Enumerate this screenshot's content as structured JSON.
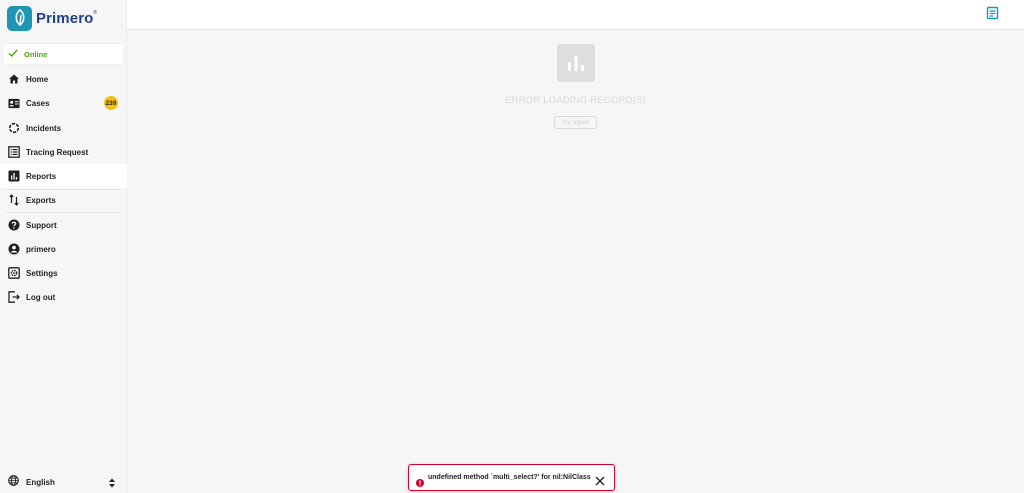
{
  "app": {
    "name": "Primero"
  },
  "status": {
    "label": "Online",
    "color": "#53a30a"
  },
  "nav": {
    "items": [
      {
        "label": "Home",
        "icon": "home-icon"
      },
      {
        "label": "Cases",
        "icon": "cases-card-icon",
        "badge": "239"
      },
      {
        "label": "Incidents",
        "icon": "incidents-icon"
      },
      {
        "label": "Tracing Request",
        "icon": "list-icon"
      },
      {
        "label": "Reports",
        "icon": "bar-chart-icon",
        "active": true
      },
      {
        "label": "Exports",
        "icon": "swap-arrows-icon"
      },
      {
        "label": "Support",
        "icon": "help-icon"
      },
      {
        "label": "primero",
        "icon": "account-icon"
      },
      {
        "label": "Settings",
        "icon": "settings-icon"
      },
      {
        "label": "Log out",
        "icon": "logout-icon"
      }
    ]
  },
  "language": {
    "selected": "English",
    "icon": "globe-icon"
  },
  "main": {
    "error_title": "ERROR LOADING RECORD(S)",
    "retry_label": "Try again"
  },
  "toast": {
    "message": "undefined method `multi_select?' for nil:NilClass",
    "color": "#d6002a"
  },
  "colors": {
    "brand": "#1f95b6",
    "badge": "#f2c10f"
  }
}
